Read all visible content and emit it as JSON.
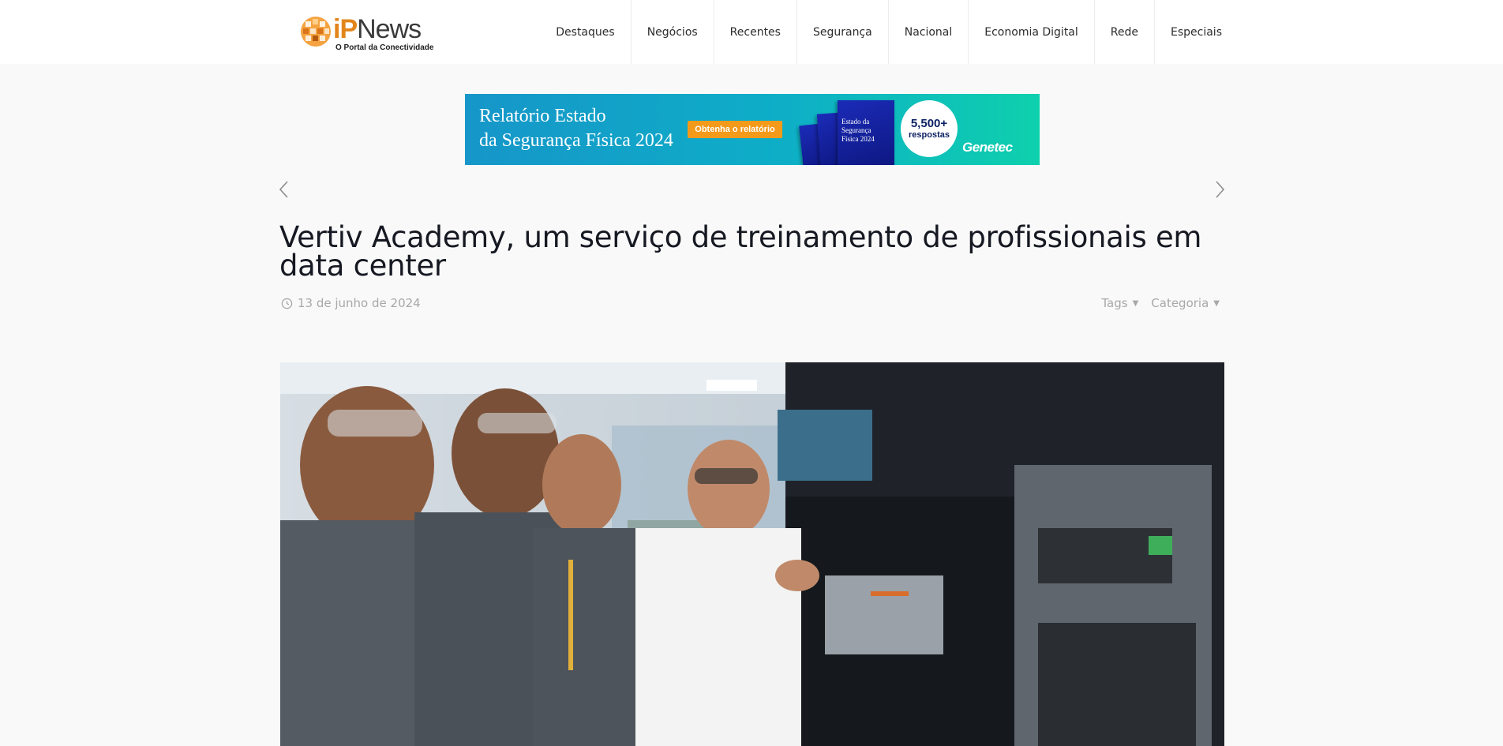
{
  "header": {
    "logo": {
      "word_ip": "iP",
      "word_news": "News",
      "tagline": "O Portal da Conectividade"
    },
    "nav": [
      "Destaques",
      "Negócios",
      "Recentes",
      "Segurança",
      "Nacional",
      "Economia Digital",
      "Rede",
      "Especiais"
    ]
  },
  "banner": {
    "line1": "Relatório Estado",
    "line2": "da Segurança Física 2024",
    "cta": "Obtenha o relatório",
    "book_text": "Estado da Segurança Física 2024",
    "badge_number": "5,500+",
    "badge_label": "respostas",
    "brand": "Genetec",
    "colors": {
      "start": "#1696c9",
      "end": "#0ed0ad",
      "cta": "#f49a1a"
    }
  },
  "post": {
    "title": "Vertiv Academy, um serviço de treinamento de profissionais em data center",
    "date": "13 de junho de 2024",
    "tags_label": "Tags",
    "category_label": "Categoria"
  },
  "icons": {
    "prev": "chevron-left-icon",
    "next": "chevron-right-icon",
    "clock": "clock-icon",
    "caret": "caret-down-icon"
  }
}
